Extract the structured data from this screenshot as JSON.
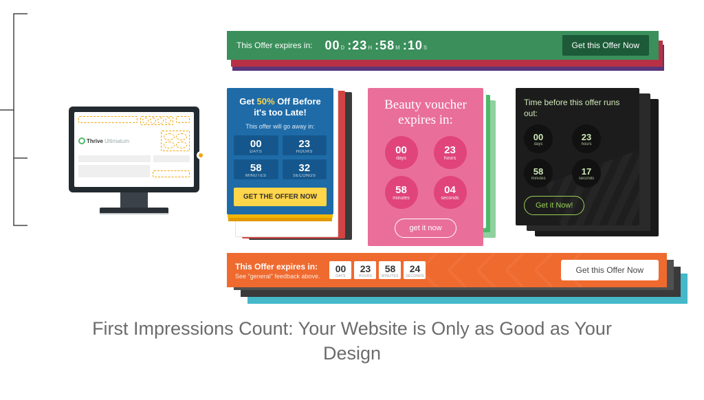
{
  "heading": "First Impressions Count: Your Website is Only as Good as Your Design",
  "monitor": {
    "brand1": "Thrive",
    "brand2": "Ultimatum"
  },
  "topbar": {
    "label": "This Offer expires in:",
    "d": "00",
    "du": "D",
    "h": "23",
    "hu": "H",
    "m": "58",
    "mu": "M",
    "s": "10",
    "su": "S",
    "cta": "Get this Offer Now"
  },
  "blue": {
    "title_pre": "Get ",
    "title_pct": "50%",
    "title_post": " Off Before it's too Late!",
    "sub": "This offer will go away in:",
    "days": "00",
    "days_l": "DAYS",
    "hours": "23",
    "hours_l": "HOURS",
    "mins": "58",
    "mins_l": "MINUTES",
    "secs": "32",
    "secs_l": "SECONDS",
    "cta": "GET THE OFFER NOW"
  },
  "pink": {
    "title": "Beauty voucher expires in:",
    "days": "00",
    "days_l": "days",
    "hours": "23",
    "hours_l": "hours",
    "mins": "58",
    "mins_l": "minutes",
    "secs": "04",
    "secs_l": "seconds",
    "cta": "get it now"
  },
  "dark": {
    "title": "Time before this offer runs out:",
    "days": "00",
    "days_l": "days",
    "hours": "23",
    "hours_l": "hours",
    "mins": "58",
    "mins_l": "minutes",
    "secs": "17",
    "secs_l": "seconds",
    "cta": "Get it Now!"
  },
  "bottombar": {
    "label": "This Offer expires in:",
    "sublabel": "See \"general\" feedback above.",
    "days": "00",
    "days_l": "DAYS",
    "hours": "23",
    "hours_l": "HOURS",
    "mins": "58",
    "mins_l": "MINUTES",
    "secs": "24",
    "secs_l": "SECONDS",
    "cta": "Get this Offer Now"
  }
}
